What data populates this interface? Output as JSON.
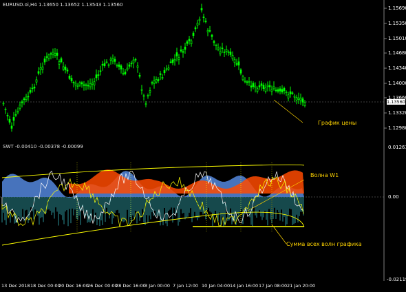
{
  "price_panel": {
    "header": "EURUSD.oi,H4  1.13650 1.13652 1.13543 1.13560",
    "price_ticks": [
      "1.15690",
      "1.15350",
      "1.15010",
      "1.14680",
      "1.14340",
      "1.14000",
      "1.13660",
      "1.13320",
      "1.12980"
    ],
    "current_price": "1.13560",
    "annotation": "График цены",
    "colors": {
      "bull": "#00ff00",
      "bear": "#00ff00",
      "background": "#000000"
    }
  },
  "indicator_panel": {
    "header": "SWT -0.00410 -0.00378 -0.00099",
    "ticks": [
      "0.01261",
      "0.00",
      "-0.02119"
    ],
    "annotations": {
      "wave": "Волна W1",
      "sum": "Сумма всех волн графика"
    },
    "colors": {
      "blue": "#4f7fd0",
      "orange": "#ff4a00",
      "yellow": "#ffff00",
      "cyan": "#40d8e0",
      "white": "#ffffff"
    }
  },
  "time_axis": [
    "13 Dec 2018",
    "18 Dec 00:00",
    "20 Dec 16:00",
    "26 Dec 00:00",
    "28 Dec 16:00",
    "3 Jan 00:00",
    "7 Jan 12:00",
    "10 Jan 04:00",
    "14 Jan 16:00",
    "17 Jan 08:00",
    "21 Jan 20:00"
  ]
}
